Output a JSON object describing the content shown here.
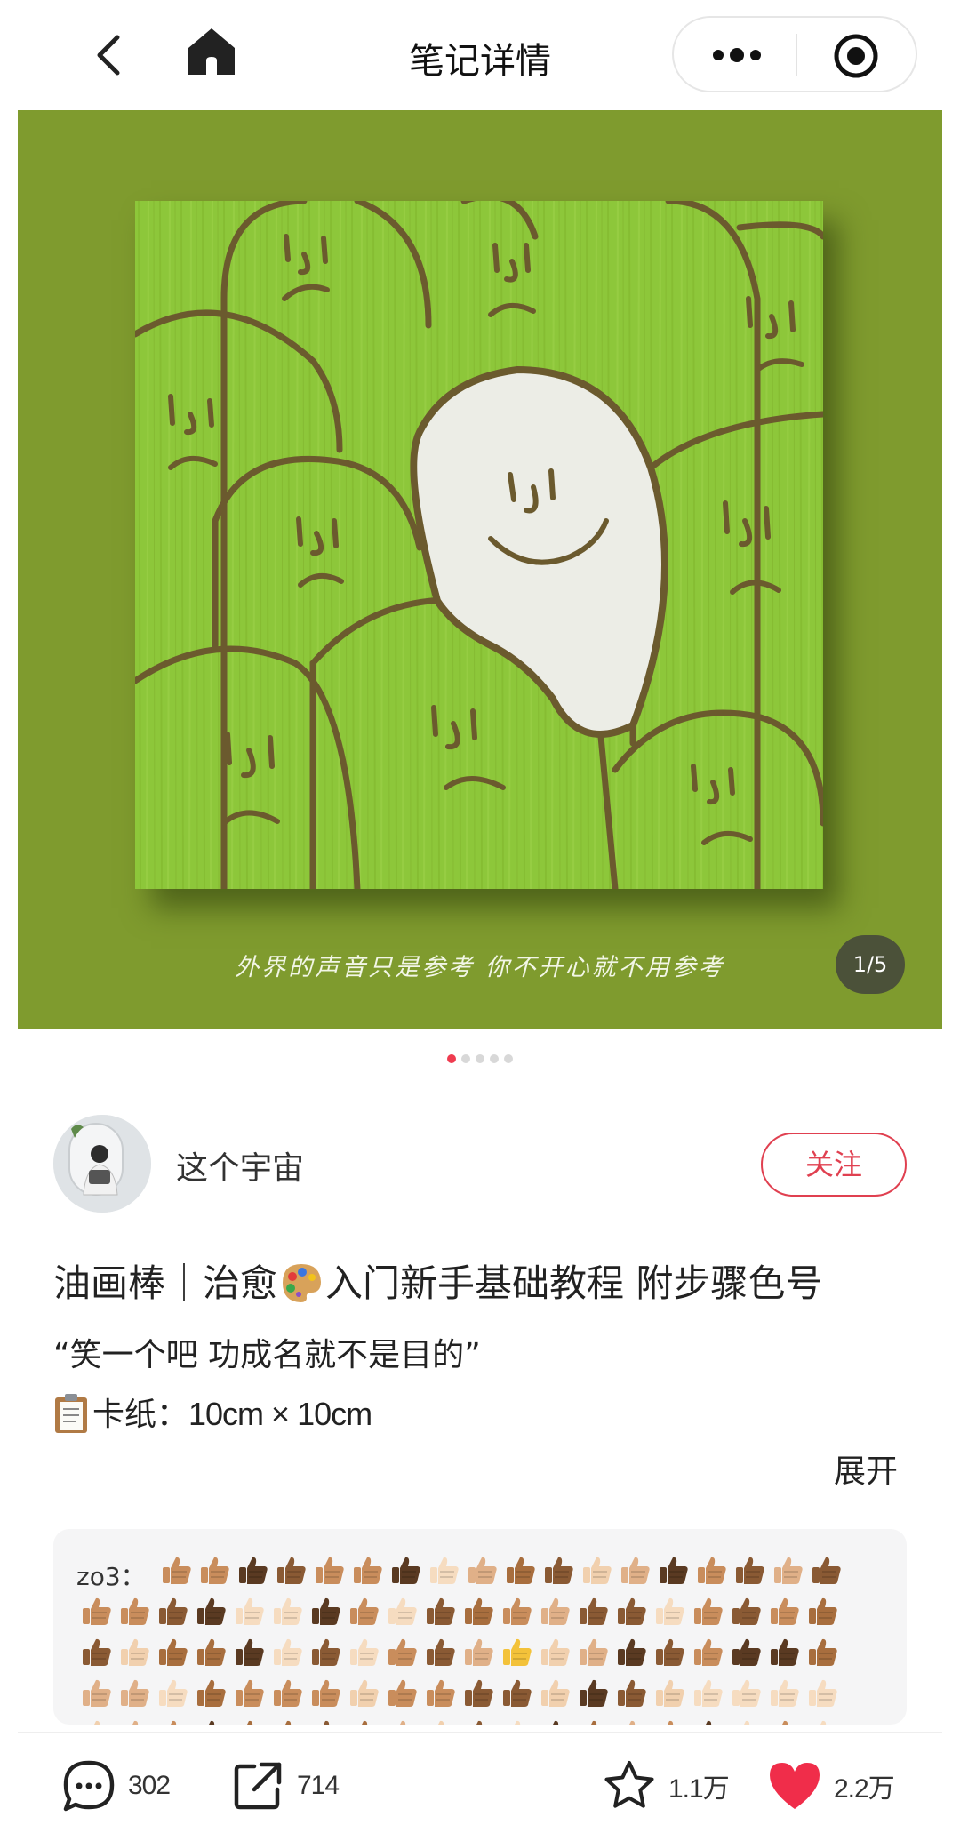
{
  "header": {
    "title": "笔记详情",
    "icons": [
      "back-icon",
      "home-icon",
      "more-icon",
      "target-icon"
    ]
  },
  "hero": {
    "caption": "外界的声音只是参考 你不开心就不用参考",
    "counter": "1/5",
    "page_index": 1,
    "page_total": 5,
    "background": "#7f9b2e"
  },
  "author": {
    "name": "这个宇宙",
    "follow_label": "关注"
  },
  "note": {
    "title_before": "油画棒｜治愈",
    "title_after": "入门新手基础教程 附步骤色号",
    "quote": "“笑一个吧 功成名就不是目的”",
    "spec_label": "卡纸：",
    "spec_value": "10cm × 10cm",
    "expand_label": "展开"
  },
  "comment": {
    "user": "zo3："
  },
  "actions": {
    "comments": "302",
    "shares": "714",
    "favorites": "1.1万",
    "likes": "2.2万"
  },
  "colors": {
    "accent": "#e04050",
    "like": "#f02d4a",
    "canvas_green": "#8cc634"
  }
}
